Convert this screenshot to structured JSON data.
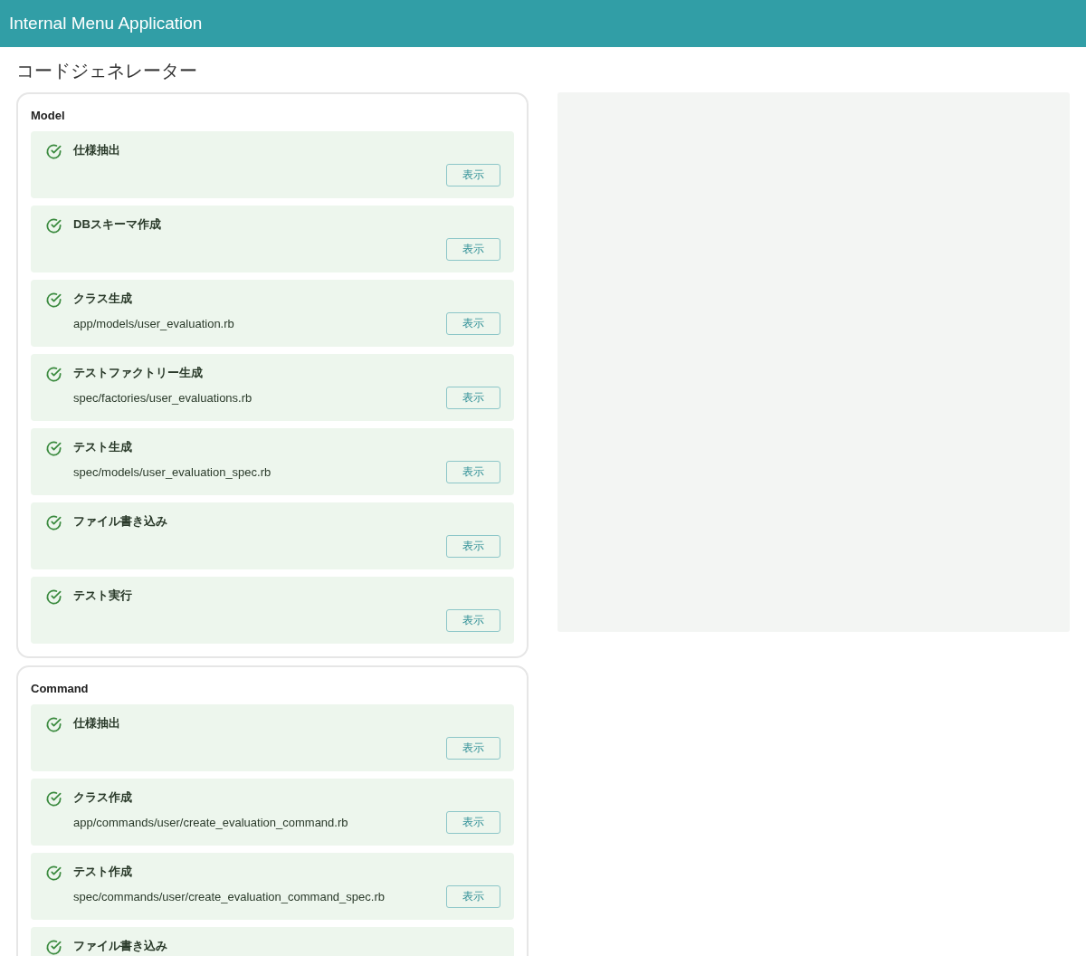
{
  "header": {
    "title": "Internal Menu Application"
  },
  "page_title": "コードジェネレーター",
  "sections": [
    {
      "title": "Model",
      "steps": [
        {
          "completed": true,
          "title": "仕様抽出",
          "button": "表示"
        },
        {
          "completed": true,
          "title": "DBスキーマ作成",
          "button": "表示"
        },
        {
          "completed": true,
          "title": "クラス生成",
          "file": "app/models/user_evaluation.rb",
          "button": "表示"
        },
        {
          "completed": true,
          "title": "テストファクトリー生成",
          "file": "spec/factories/user_evaluations.rb",
          "button": "表示"
        },
        {
          "completed": true,
          "title": "テスト生成",
          "file": "spec/models/user_evaluation_spec.rb",
          "button": "表示"
        },
        {
          "completed": true,
          "title": "ファイル書き込み",
          "button": "表示"
        },
        {
          "completed": true,
          "title": "テスト実行",
          "button": "表示"
        }
      ]
    },
    {
      "title": "Command",
      "steps": [
        {
          "completed": true,
          "title": "仕様抽出",
          "button": "表示"
        },
        {
          "completed": true,
          "title": "クラス作成",
          "file": "app/commands/user/create_evaluation_command.rb",
          "button": "表示"
        },
        {
          "completed": true,
          "title": "テスト作成",
          "file": "spec/commands/user/create_evaluation_command_spec.rb",
          "button": "表示"
        },
        {
          "completed": true,
          "title": "ファイル書き込み"
        }
      ]
    }
  ]
}
